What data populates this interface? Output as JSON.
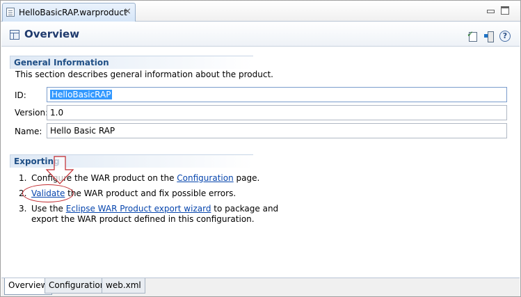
{
  "editor_tab": {
    "title": "HelloBasicRAP.warproduct",
    "close_glyph": "⨯"
  },
  "header": {
    "title": "Overview",
    "help_glyph": "?"
  },
  "general": {
    "title": "General Information",
    "description": "This section describes general information about the product.",
    "fields": {
      "id_label": "ID:",
      "id_value": "HelloBasicRAP",
      "version_label": "Version:",
      "version_value": "1.0",
      "name_label": "Name:",
      "name_value": "Hello Basic RAP"
    }
  },
  "exporting": {
    "title": "Exporting",
    "step1": {
      "num": "1.",
      "before": "Configure the WAR product on the ",
      "link": "Configuration",
      "after": " page."
    },
    "step2": {
      "num": "2.",
      "link": "Validate",
      "after": " the WAR product and fix possible errors."
    },
    "step3": {
      "num": "3.",
      "before": "Use the ",
      "link": "Eclipse WAR Product export wizard",
      "after": " to package and",
      "line2": "export the WAR product defined in this configuration."
    }
  },
  "bottom_tabs": [
    "Overview",
    "Configuration",
    "web.xml"
  ],
  "colors": {
    "section_title": "#1f4f86",
    "link": "#0645ad",
    "annotation": "#c0282d",
    "selection": "#3399ff"
  }
}
